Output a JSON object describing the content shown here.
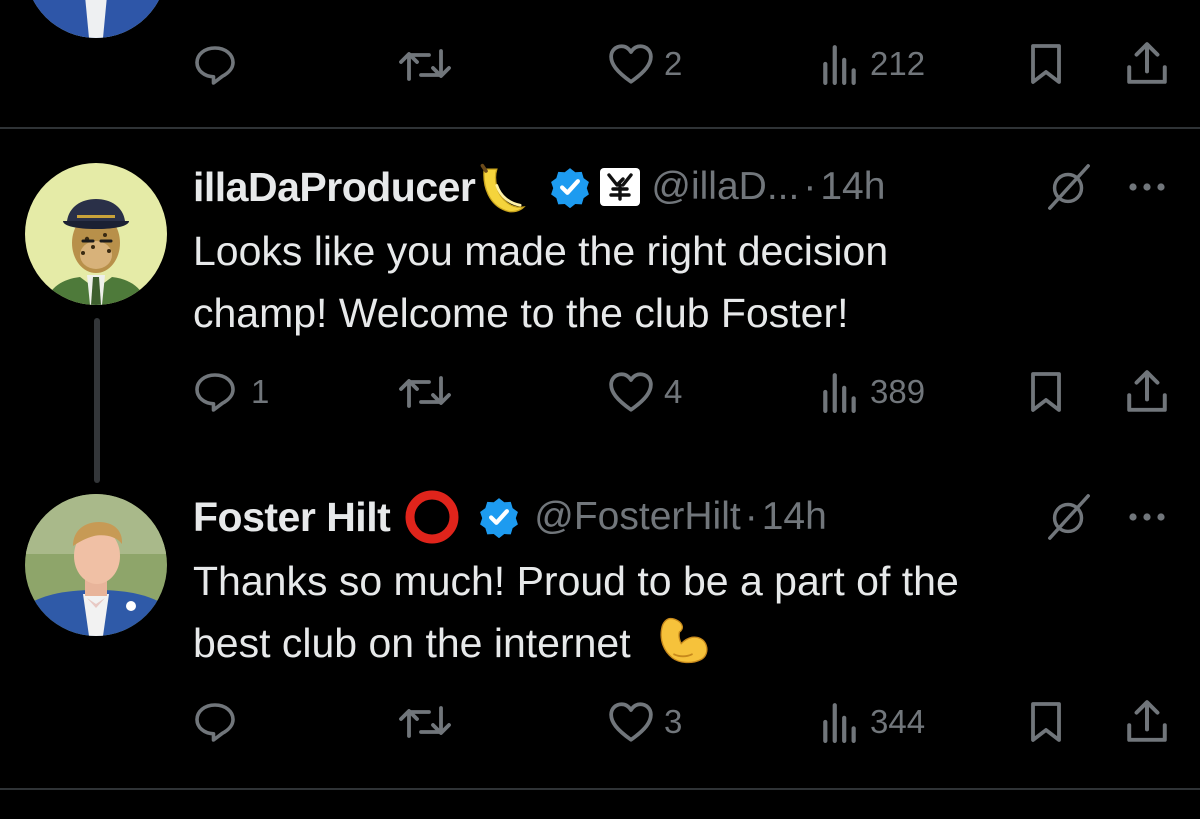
{
  "top_tweet": {
    "actions": {
      "reply": "",
      "retweet": "",
      "likes": "2",
      "views": "212"
    }
  },
  "reply1": {
    "name": "illaDaProducer",
    "handle": "@illaD...",
    "separator": "·",
    "time": "14h",
    "text_lines": [
      "Looks like you made the right decision",
      "champ! Welcome to the club Foster!"
    ],
    "actions": {
      "reply": "1",
      "retweet": "",
      "likes": "4",
      "views": "389"
    }
  },
  "reply2": {
    "name": "Foster Hilt",
    "handle": "@FosterHilt",
    "separator": "·",
    "time": "14h",
    "text_lines": [
      "Thanks so much! Proud to be a part of the",
      "best club on the internet"
    ],
    "actions": {
      "reply": "",
      "retweet": "",
      "likes": "3",
      "views": "344"
    }
  },
  "colors": {
    "background": "#000000",
    "text": "#e7e9ea",
    "muted": "#71767b",
    "verified": "#1d9bf0",
    "divider": "#2f3336",
    "ring_red": "#e0241b"
  },
  "icons": [
    "reply-icon",
    "retweet-icon",
    "like-icon",
    "views-icon",
    "bookmark-icon",
    "share-icon",
    "grok-icon",
    "more-icon",
    "verified-badge-icon",
    "banana-emoji-icon",
    "flexed-biceps-emoji-icon",
    "red-circle-emoji-icon",
    "affiliate-badge-icon"
  ]
}
